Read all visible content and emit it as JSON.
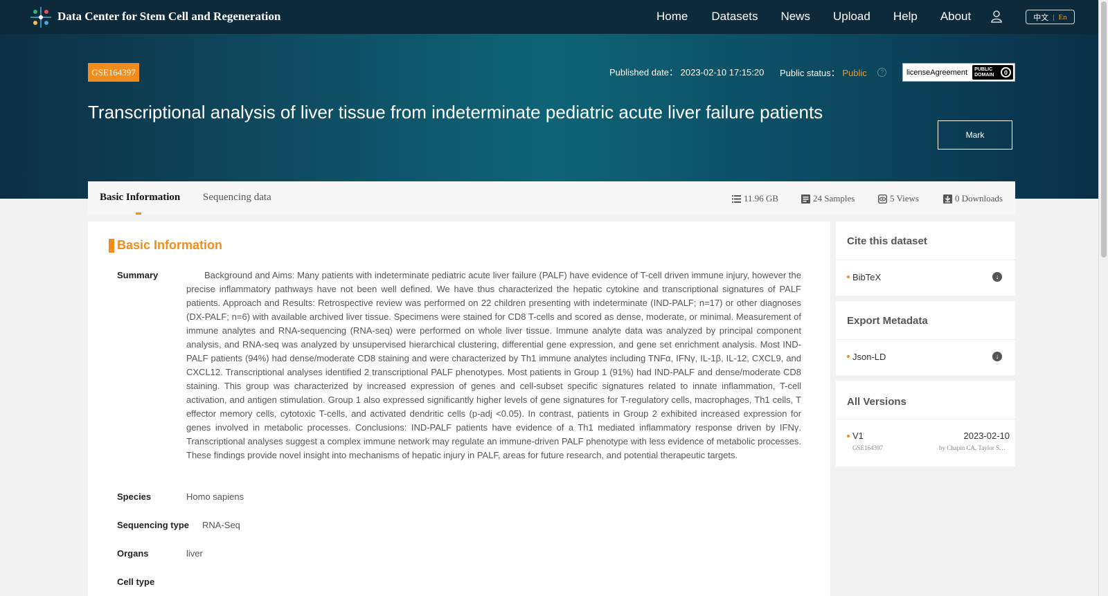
{
  "navbar": {
    "brand": "Data Center for Stem Cell and Regeneration",
    "links": [
      "Home",
      "Datasets",
      "News",
      "Upload",
      "Help",
      "About"
    ],
    "lang_zh": "中文",
    "lang_sep": "|",
    "lang_en": "En"
  },
  "hero": {
    "accession": "GSE164397",
    "published_label": "Published date：",
    "published_value": "2023-02-10 17:15:20",
    "status_label": "Public status：",
    "status_value": "Public",
    "license_text": "licenseAgreement",
    "license_badge_line1": "PUBLIC",
    "license_badge_line2": "DOMAIN",
    "title": "Transcriptional analysis of liver tissue from indeterminate pediatric acute liver failure patients",
    "mark_label": "Mark"
  },
  "tabs": {
    "active": "Basic Information",
    "inactive": "Sequencing data"
  },
  "stats": {
    "size": "11.96 GB",
    "samples": "24 Samples",
    "views": "5 Views",
    "downloads": "0 Downloads"
  },
  "basic_info": {
    "section_title": "Basic Information",
    "summary_label": "Summary",
    "summary": "Background and Aims: Many patients with indeterminate pediatric acute liver failure (PALF) have evidence of T-cell driven immune injury, however the precise inflammatory pathways have not been well defined. We have thus characterized the hepatic cytokine and transcriptional signatures of PALF patients. Approach and Results: Retrospective review was performed on 22 children presenting with indeterminate (IND-PALF; n=17) or other diagnoses (DX-PALF; n=6) with available archived liver tissue. Specimens were stained for CD8 T-cells and scored as dense, moderate, or minimal. Measurement of immune analytes and RNA-sequencing (RNA-seq) were performed on whole liver tissue. Immune analyte data was analyzed by principal component analysis, and RNA-seq was analyzed by unsupervised hierarchical clustering, differential gene expression, and gene set enrichment analysis. Most IND-PALF patients (94%) had dense/moderate CD8 staining and were characterized by Th1 immune analytes including TNFα, IFNγ, IL-1β, IL-12, CXCL9, and CXCL12. Transcriptional analyses identified 2 transcriptional PALF phenotypes. Most patients in Group 1 (91%) had IND-PALF and dense/moderate CD8 staining. This group was characterized by increased expression of genes and cell-subset specific signatures related to innate inflammation, T-cell activation, and antigen stimulation. Group 1 also expressed significantly higher levels of gene signatures for T-regulatory cells, macrophages, Th1 cells, T effector memory cells, cytotoxic T-cells, and activated dendritic cells (p-adj <0.05). In contrast, patients in Group 2 exhibited increased expression for genes involved in metabolic processes. Conclusions: IND-PALF patients have evidence of a Th1 mediated inflammatory response driven by IFNγ. Transcriptional analyses suggest a complex immune network may regulate an immune-driven PALF phenotype with less evidence of metabolic processes. These findings provide novel insight into mechanisms of hepatic injury in PALF, areas for future research, and potential therapeutic targets.",
    "species_label": "Species",
    "species": "Homo sapiens",
    "seqtype_label": "Sequencing type",
    "seqtype": "RNA-Seq",
    "organs_label": "Organs",
    "organs": "liver",
    "celltype_label": "Cell type"
  },
  "sidebar": {
    "cite_title": "Cite this dataset",
    "cite_item": "BibTeX",
    "export_title": "Export Metadata",
    "export_item": "Json-LD",
    "versions_title": "All Versions",
    "version": {
      "name": "V1",
      "date": "2023-02-10",
      "accession": "GSE164397",
      "by": "by Chapin CA, Taylor S…"
    }
  },
  "colors": {
    "accent": "#f28c1a",
    "navbar": "#0c2a3a"
  },
  "icons": [
    "logo-icon",
    "user-icon",
    "help-icon",
    "list-icon",
    "samples-icon",
    "views-icon",
    "downloads-icon",
    "download-circle-icon"
  ]
}
